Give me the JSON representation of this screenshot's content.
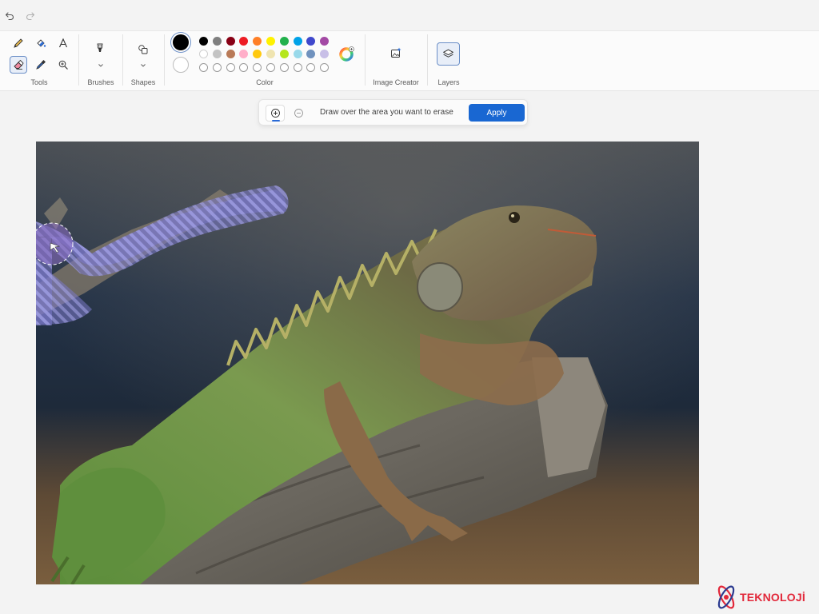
{
  "titlebar": {
    "undo_icon": "undo-icon",
    "redo_icon": "redo-icon"
  },
  "ribbon": {
    "tools_label": "Tools",
    "brushes_label": "Brushes",
    "shapes_label": "Shapes",
    "color_label": "Color",
    "image_creator_label": "Image Creator",
    "layers_label": "Layers",
    "tools": [
      "pencil-icon",
      "fill-icon",
      "text-icon",
      "eraser-icon",
      "color-picker-icon",
      "magnifier-icon"
    ],
    "active_tool": "eraser-icon",
    "colors": {
      "primary": "#000000",
      "secondary": "#ffffff",
      "row1": [
        "#000000",
        "#7f7f7f",
        "#880015",
        "#ed1c24",
        "#ff7f27",
        "#fff200",
        "#22b14c",
        "#00a2e8",
        "#3f48cc",
        "#a349a4"
      ],
      "row2": [
        "#ffffff",
        "#c3c3c3",
        "#b97a57",
        "#ffaec9",
        "#ffc90e",
        "#efe4b0",
        "#b5e61d",
        "#99d9ea",
        "#7092be",
        "#c8bfe7"
      ]
    }
  },
  "erase_bar": {
    "add_icon": "plus-circle-icon",
    "remove_icon": "minus-circle-icon",
    "instruction": "Draw over the area you want to erase",
    "apply_label": "Apply"
  },
  "watermark": {
    "text": "TEKNOLOJİ"
  }
}
